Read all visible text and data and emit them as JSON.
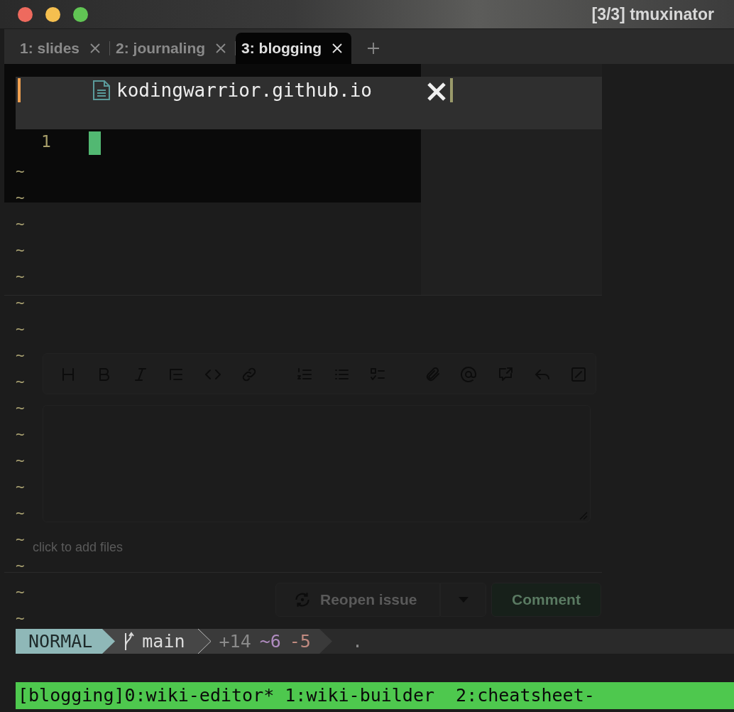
{
  "window": {
    "title": "[3/3] tmuxinator"
  },
  "tabs": [
    {
      "label": "1: slides",
      "selected": false
    },
    {
      "label": "2: journaling",
      "selected": false
    },
    {
      "label": "3: blogging",
      "selected": true
    }
  ],
  "popup": {
    "title": "kodingwarrior.github.io"
  },
  "editor": {
    "line_numbers": [
      "1"
    ],
    "empty_lines": [
      "~",
      "~",
      "~",
      "~",
      "~",
      "~",
      "~",
      "~",
      "~",
      "~",
      "~",
      "~",
      "~",
      "~",
      "~",
      "~",
      "~",
      "~"
    ]
  },
  "background_page": {
    "attach_hint": "click to add files",
    "buttons": [
      {
        "label": "Reopen issue",
        "kind": "secondary"
      },
      {
        "label": "Comment",
        "kind": "primary"
      }
    ]
  },
  "statusline": {
    "mode": "NORMAL",
    "branch": "main",
    "added": "+14",
    "changed": "~6",
    "removed": "-5",
    "extra": "."
  },
  "tmux_bar": {
    "text": "[blogging]0:wiki-editor* 1:wiki-builder  2:cheatsheet-"
  }
}
